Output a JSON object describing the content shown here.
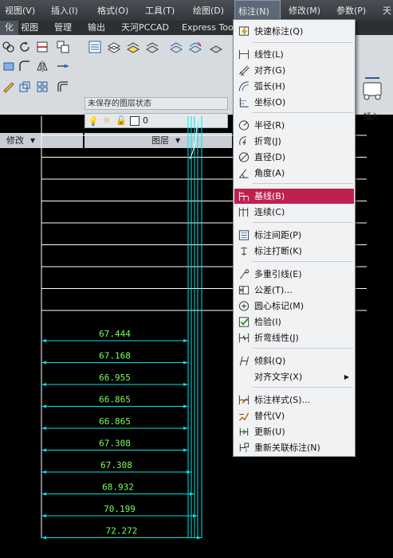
{
  "menubar": {
    "items": [
      "视图(V)",
      "插入(I)",
      "格式(O)",
      "工具(T)",
      "绘图(D)",
      "标注(N)",
      "修改(M)",
      "参数(P)",
      "天"
    ],
    "active": "标注(N)"
  },
  "ribbon_tabs": {
    "items": [
      "化",
      "视图",
      "管理",
      "输出",
      "天河PCCAD",
      "Express Tools"
    ],
    "active": "化"
  },
  "ribbon": {
    "modify_panel": "修改",
    "layers_panel": "图层",
    "layer_state": "未保存的图层状态",
    "layer_name": "0",
    "insert_label": "插入"
  },
  "dimension_menu": {
    "items": [
      {
        "label": "快速标注(Q)",
        "icon": "quick-dimension-icon"
      },
      {
        "label": "线性(L)",
        "icon": "linear-dimension-icon"
      },
      {
        "label": "对齐(G)",
        "icon": "aligned-dimension-icon"
      },
      {
        "label": "弧长(H)",
        "icon": "arc-length-icon"
      },
      {
        "label": "坐标(O)",
        "icon": "ordinate-icon"
      },
      {
        "label": "半径(R)",
        "icon": "radius-icon"
      },
      {
        "label": "折弯(J)",
        "icon": "jogged-icon"
      },
      {
        "label": "直径(D)",
        "icon": "diameter-icon"
      },
      {
        "label": "角度(A)",
        "icon": "angular-icon"
      },
      {
        "label": "基线(B)",
        "icon": "baseline-icon",
        "highlighted": true
      },
      {
        "label": "连续(C)",
        "icon": "continue-icon"
      },
      {
        "label": "标注间距(P)",
        "icon": "dimension-space-icon"
      },
      {
        "label": "标注打断(K)",
        "icon": "dimension-break-icon"
      },
      {
        "label": "多重引线(E)",
        "icon": "multileader-icon"
      },
      {
        "label": "公差(T)...",
        "icon": "tolerance-icon"
      },
      {
        "label": "圆心标记(M)",
        "icon": "center-mark-icon"
      },
      {
        "label": "检验(I)",
        "icon": "inspection-icon"
      },
      {
        "label": "折弯线性(J)",
        "icon": "jogged-linear-icon"
      },
      {
        "label": "倾斜(Q)",
        "icon": "oblique-icon"
      },
      {
        "label": "对齐文字(X)",
        "icon": "",
        "submenu": true
      },
      {
        "label": "标注样式(S)...",
        "icon": "dimension-style-icon"
      },
      {
        "label": "替代(V)",
        "icon": "override-icon"
      },
      {
        "label": "更新(U)",
        "icon": "update-icon"
      },
      {
        "label": "重新关联标注(N)",
        "icon": "reassociate-icon"
      }
    ]
  },
  "drawing": {
    "dimensions": [
      "67.444",
      "67.168",
      "66.955",
      "66.865",
      "66.865",
      "67.308",
      "67.308",
      "68.932",
      "70.199",
      "72.272"
    ],
    "line_color": "#ffffff",
    "dim_color": "#00e5e5",
    "text_color": "#7cff5a"
  }
}
